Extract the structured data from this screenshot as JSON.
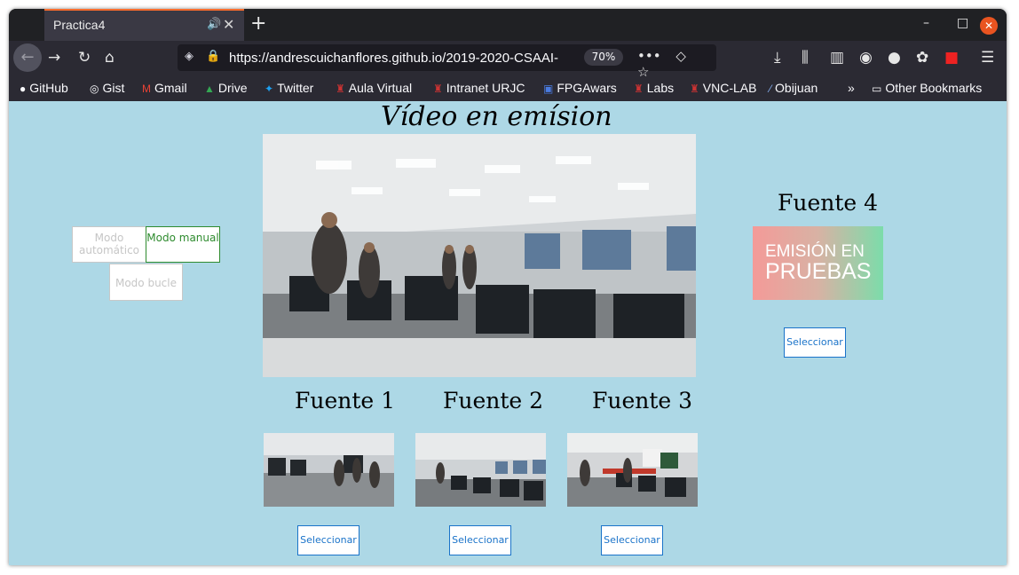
{
  "browser": {
    "tab_title": "Practica4",
    "url": "https://andrescuichanflores.github.io/2019-2020-CSAAI-",
    "zoom": "70%",
    "bookmarks": [
      "GitHub",
      "Gist",
      "Gmail",
      "Drive",
      "Twitter",
      "Aula Virtual",
      "Intranet URJC",
      "FPGAwars",
      "Labs",
      "VNC-LAB",
      "Obijuan",
      "Other Bookmarks"
    ]
  },
  "page": {
    "title": "Vídeo en emísion",
    "modes": {
      "auto": "Modo automático",
      "manual": "Modo manual",
      "loop": "Modo bucle"
    },
    "source4": {
      "title": "Fuente 4",
      "test_line1": "EMISIÓN EN",
      "test_line2": "PRUEBAS"
    },
    "source1": {
      "title": "Fuente 1"
    },
    "source2": {
      "title": "Fuente 2"
    },
    "source3": {
      "title": "Fuente 3"
    },
    "select_label": "Seleccionar"
  },
  "colors": {
    "page_bg": "#add8e6",
    "manual_active": "#2e8b2e",
    "select_accent": "#1a73c9",
    "tab_accent": "#ff6d2e"
  }
}
